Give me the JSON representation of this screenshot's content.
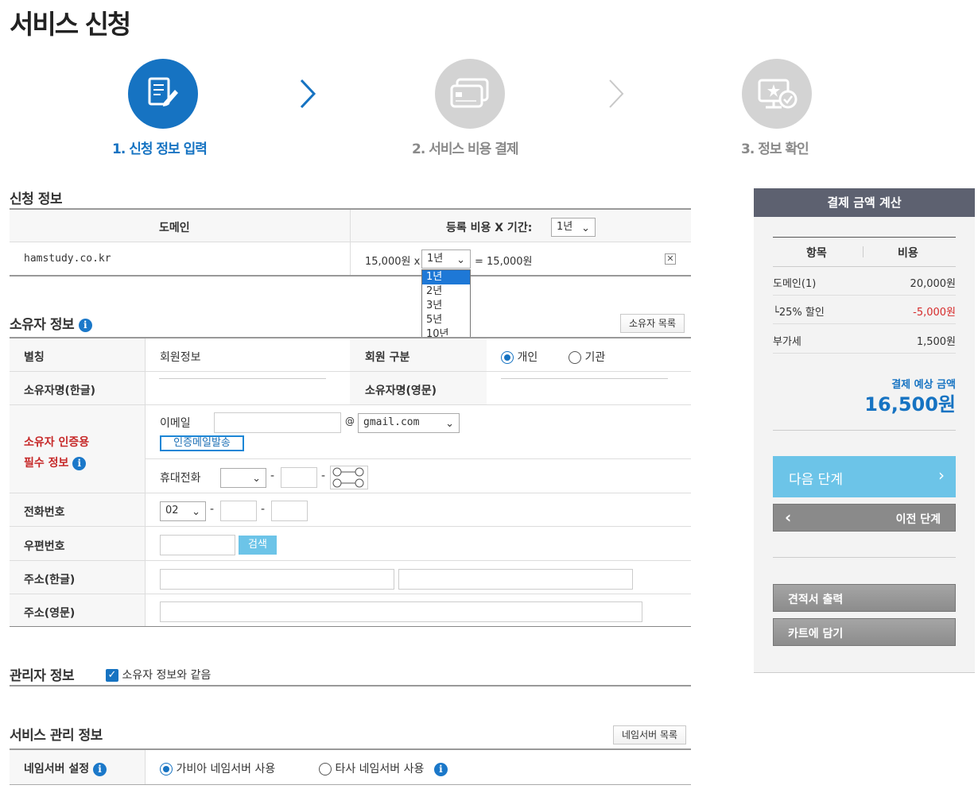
{
  "page_title": "서비스 신청",
  "steps": [
    {
      "label": "1. 신청 정보 입력",
      "icon": "edit-document-icon",
      "active": true
    },
    {
      "label": "2. 서비스 비용 결제",
      "icon": "credit-card-icon",
      "active": false
    },
    {
      "label": "3. 정보 확인",
      "icon": "monitor-check-icon",
      "active": false
    }
  ],
  "application": {
    "title": "신청 정보",
    "col_domain": "도메인",
    "col_fee": "등록 비용 X 기간:",
    "period_all": "1년",
    "row": {
      "domain": "hamstudy.co.kr",
      "price": "15,000원 x",
      "period": "1년",
      "total": "= 15,000원"
    },
    "period_options": [
      "1년",
      "2년",
      "3년",
      "5년",
      "10년"
    ],
    "selected_option": "1년"
  },
  "owner": {
    "title": "소유자 정보",
    "list_button": "소유자 목록",
    "nickname_label": "별칭",
    "nickname_value": "회원정보",
    "member_type_label": "회원 구분",
    "member_type_options": [
      "개인",
      "기관"
    ],
    "member_type_selected": "개인",
    "name_kr_label": "소유자명(한글)",
    "name_en_label": "소유자명(영문)",
    "auth_label_1": "소유자 인증용",
    "auth_label_2": "필수 정보",
    "email_label": "이메일",
    "email_at": "@",
    "email_domain": "gmail.com",
    "send_auth_button": "인증메일발송",
    "mobile_label": "휴대전화",
    "dash": "-",
    "phone_label": "전화번호",
    "phone_area": "02",
    "zip_label": "우편번호",
    "zip_search_button": "검색",
    "addr_kr_label": "주소(한글)",
    "addr_en_label": "주소(영문)"
  },
  "admin": {
    "title": "관리자 정보",
    "same_as_owner": "소유자 정보와 같음",
    "same_checked": true
  },
  "service": {
    "title": "서비스 관리 정보",
    "ns_list_button": "네임서버 목록",
    "ns_label": "네임서버 설정",
    "ns_options": [
      "가비아 네임서버 사용",
      "타사 네임서버 사용"
    ],
    "ns_selected": "가비아 네임서버 사용"
  },
  "summary": {
    "title": "결제 금액 계산",
    "col_item": "항목",
    "col_cost": "비용",
    "rows": [
      {
        "item": "도메인(1)",
        "cost": "20,000원"
      },
      {
        "item": "└25% 할인",
        "cost": "-5,000원"
      },
      {
        "item": "부가세",
        "cost": "1,500원"
      }
    ],
    "expected_label": "결제 예상 금액",
    "expected_amount": "16,500원",
    "next_button": "다음 단계",
    "prev_button": "이전 단계",
    "quote_button": "견적서 출력",
    "cart_button": "카트에 담기"
  },
  "colors": {
    "brand_blue": "#1673c2",
    "discount_red": "#d62b2b",
    "next_button": "#6cc4e8",
    "panel_header": "#5d6170"
  }
}
